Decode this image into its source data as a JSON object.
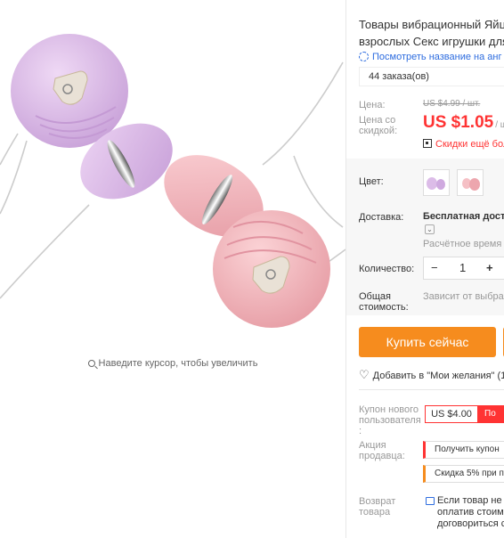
{
  "gallery": {
    "zoom_hint": "Наведите курсор, чтобы увеличить"
  },
  "product": {
    "title_line1": "Товары вибрационный Яйц",
    "title_line2": "взрослых Секс игрушки для",
    "translate_link": "Посмотреть название на анг",
    "orders": "44 заказа(ов)"
  },
  "price": {
    "label": "Цена:",
    "old_value": "US $4.99 / шт.",
    "discount_label_1": "Цена со",
    "discount_label_2": "скидкой:",
    "new_value": "US $1.05",
    "new_unit": "/ ш",
    "promo_text": "Скидки ещё бол"
  },
  "options": {
    "color_label": "Цвет:",
    "delivery_label": "Доставка:",
    "delivery_value": "Бесплатная достав",
    "delivery_estimate": "Расчётное время до",
    "quantity_label": "Количество:",
    "quantity_value": "1",
    "minus": "−",
    "plus": "+",
    "total_label_1": "Общая",
    "total_label_2": "стоимость:",
    "total_value": "Зависит от выбран"
  },
  "actions": {
    "buy_now": "Купить сейчас",
    "wishlist": "Добавить в \"Мои желания\" (1"
  },
  "promotions": {
    "new_user_label_1": "Купон нового",
    "new_user_label_2": "пользователя",
    "new_user_label_3": ":",
    "coupon_value": "US $4.00",
    "coupon_get": "По",
    "seller_label_1": "Акция",
    "seller_label_2": "продавца:",
    "seller_tag_1": "Получить купон",
    "seller_tag_2": "Скидка 5% при п",
    "return_label_1": "Возврат",
    "return_label_2": "товара",
    "return_text_1": "Если товар не с",
    "return_text_2": "оплатив стоимо",
    "return_text_3": "договориться с"
  },
  "colors": {
    "accent_orange": "#f68c1e",
    "price_red": "#ff3333",
    "link_blue": "#2d6cdf",
    "lilac": "#d9b6e6",
    "pink": "#f2b3bb"
  }
}
